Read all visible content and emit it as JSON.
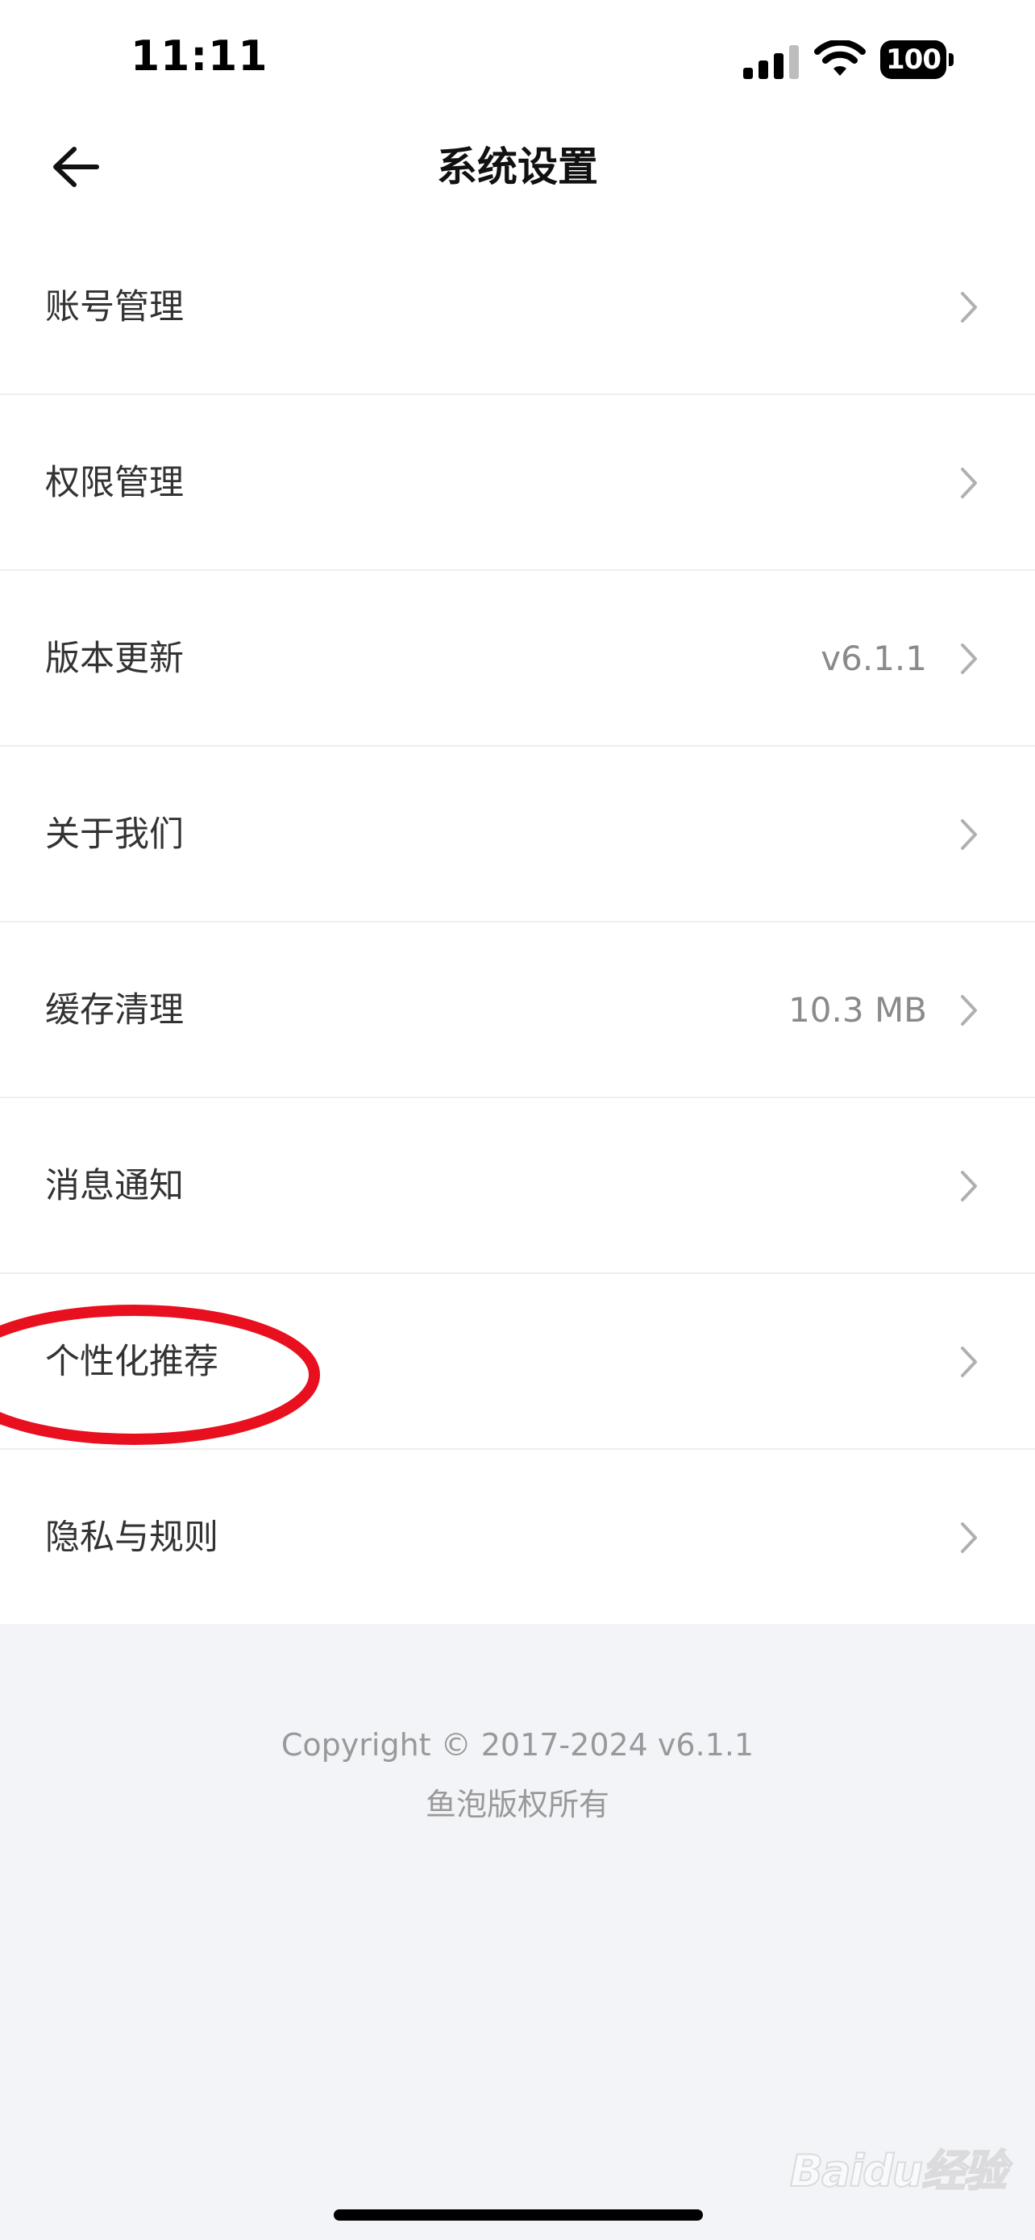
{
  "status_bar": {
    "time": "11:11",
    "battery_level": "100",
    "signal_icon": "cellular-signal-icon",
    "wifi_icon": "wifi-icon"
  },
  "header": {
    "title": "系统设置",
    "back_icon": "back-arrow-icon"
  },
  "settings": {
    "items": [
      {
        "label": "账号管理",
        "value": ""
      },
      {
        "label": "权限管理",
        "value": ""
      },
      {
        "label": "版本更新",
        "value": "v6.1.1"
      },
      {
        "label": "关于我们",
        "value": ""
      },
      {
        "label": "缓存清理",
        "value": "10.3 MB"
      },
      {
        "label": "消息通知",
        "value": ""
      },
      {
        "label": "个性化推荐",
        "value": ""
      },
      {
        "label": "隐私与规则",
        "value": ""
      }
    ],
    "chevron_icon": "chevron-right-icon"
  },
  "footer": {
    "copyright": "Copyright © 2017-2024 v6.1.1",
    "owner": "鱼泡版权所有"
  },
  "annotation": {
    "highlight_color": "#e8101e",
    "highlighted_item": "个性化推荐"
  },
  "watermark": {
    "text": "Baidu经验"
  },
  "colors": {
    "page_background": "#f3f4f8",
    "card_background": "#ffffff",
    "label_text": "#333333",
    "secondary_text": "#8a8a8a",
    "footer_text": "#999999",
    "divider": "#eeeeee"
  }
}
